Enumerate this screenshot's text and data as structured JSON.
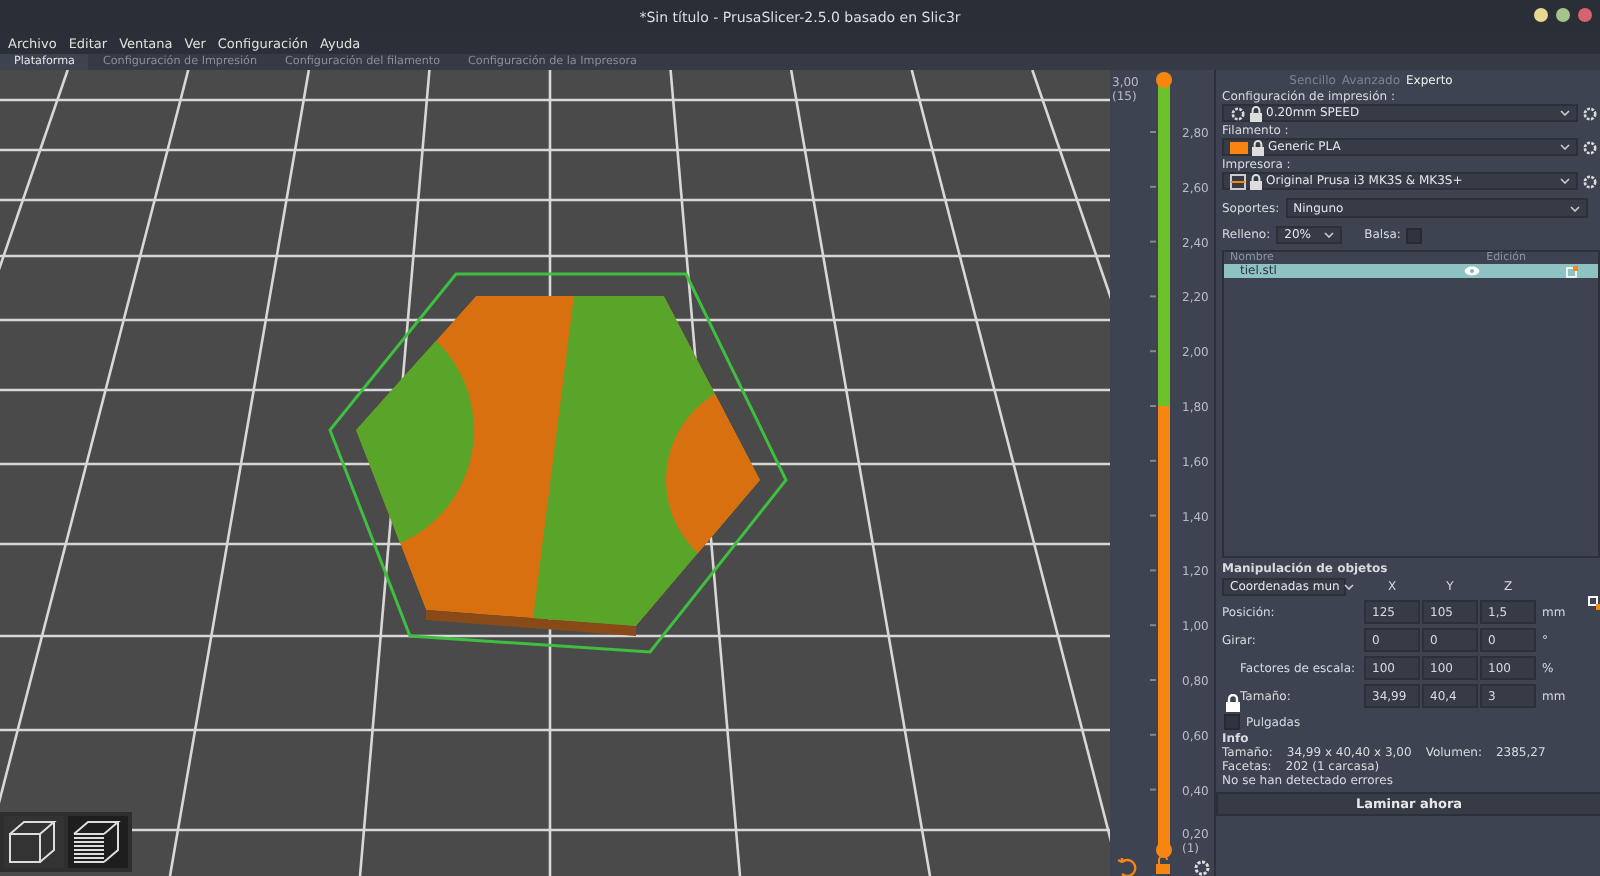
{
  "window": {
    "title": "*Sin título - PrusaSlicer-2.5.0 basado en Slic3r"
  },
  "menu": [
    "Archivo",
    "Editar",
    "Ventana",
    "Ver",
    "Configuración",
    "Ayuda"
  ],
  "tabs": [
    {
      "label": "Plataforma",
      "selected": true
    },
    {
      "label": "Configuración de Impresión",
      "selected": false
    },
    {
      "label": "Configuración del filamento",
      "selected": false
    },
    {
      "label": "Configuración de la Impresora",
      "selected": false
    }
  ],
  "layer_slider": {
    "top_value": "3,00",
    "top_layer": "(15)",
    "bottom_value": "0,20",
    "bottom_layer": "(1)",
    "ticks": [
      "2,80",
      "2,60",
      "2,40",
      "2,20",
      "2,00",
      "1,80",
      "1,60",
      "1,40",
      "1,20",
      "1,00",
      "0,80",
      "0,60",
      "0,40"
    ]
  },
  "modes": [
    {
      "label": "Sencillo",
      "selected": false
    },
    {
      "label": "Avanzado",
      "selected": false
    },
    {
      "label": "Experto",
      "selected": true
    }
  ],
  "presets": [
    {
      "kind": "print",
      "label": "Configuración de impresión :",
      "value": "0.20mm SPEED"
    },
    {
      "kind": "filament",
      "label": "Filamento :",
      "value": "Generic PLA",
      "color": "#f7850f"
    },
    {
      "kind": "printer",
      "label": "Impresora :",
      "value": "Original Prusa i3 MK3S & MK3S+"
    }
  ],
  "supports": {
    "label": "Soportes:",
    "value": "Ninguno"
  },
  "infill": {
    "label": "Relleno:",
    "value": "20%"
  },
  "brim": {
    "label": "Balsa:",
    "checked": false
  },
  "object_list": {
    "columns": [
      "Nombre",
      "Edición"
    ],
    "rows": [
      {
        "name": "tiel.stl",
        "selected": true
      }
    ]
  },
  "manipulation": {
    "title": "Manipulación de objetos",
    "coordinates": "Coordenadas mun",
    "axes": [
      "X",
      "Y",
      "Z"
    ],
    "rows": [
      {
        "label": "Posición:",
        "values": [
          "125",
          "105",
          "1,5"
        ],
        "unit": "mm"
      },
      {
        "label": "Girar:",
        "values": [
          "0",
          "0",
          "0"
        ],
        "unit": "°"
      },
      {
        "label": "Factores de escala:",
        "values": [
          "100",
          "100",
          "100"
        ],
        "unit": "%"
      },
      {
        "label": "Tamaño:",
        "values": [
          "34,99",
          "40,4",
          "3"
        ],
        "unit": "mm"
      }
    ],
    "inches": {
      "label": "Pulgadas",
      "checked": false
    }
  },
  "info": {
    "title": "Info",
    "size_label": "Tamaño:",
    "size": "34,99 x 40,40 x 3,00",
    "volume_label": "Volumen:",
    "volume": "2385,27",
    "facets_label": "Facetas:",
    "facets": "202 (1 carcasa)",
    "status": "No se han detectado errores"
  },
  "slice_button": "Laminar ahora"
}
